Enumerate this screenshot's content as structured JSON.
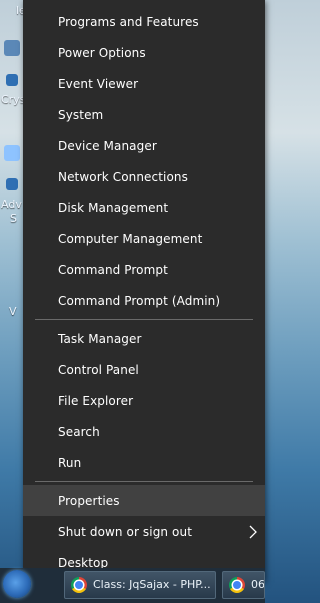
{
  "desktop": {
    "labels": [
      "le",
      "Crys",
      "Adv",
      "S",
      "V"
    ]
  },
  "menu": {
    "group1": [
      "Programs and Features",
      "Power Options",
      "Event Viewer",
      "System",
      "Device Manager",
      "Network Connections",
      "Disk Management",
      "Computer Management",
      "Command Prompt",
      "Command Prompt (Admin)"
    ],
    "group2": [
      "Task Manager",
      "Control Panel",
      "File Explorer",
      "Search",
      "Run"
    ],
    "group3": [
      "Properties",
      "Shut down or sign out",
      "Desktop"
    ],
    "highlighted_item": "Properties"
  },
  "taskbar": {
    "buttons": [
      "Class: JqSajax - PHP...",
      "06"
    ]
  },
  "colors": {
    "menu_bg": "#2b2b2b",
    "menu_hover": "#414141",
    "text": "#ffffff",
    "separator": "#6a6a6a"
  }
}
